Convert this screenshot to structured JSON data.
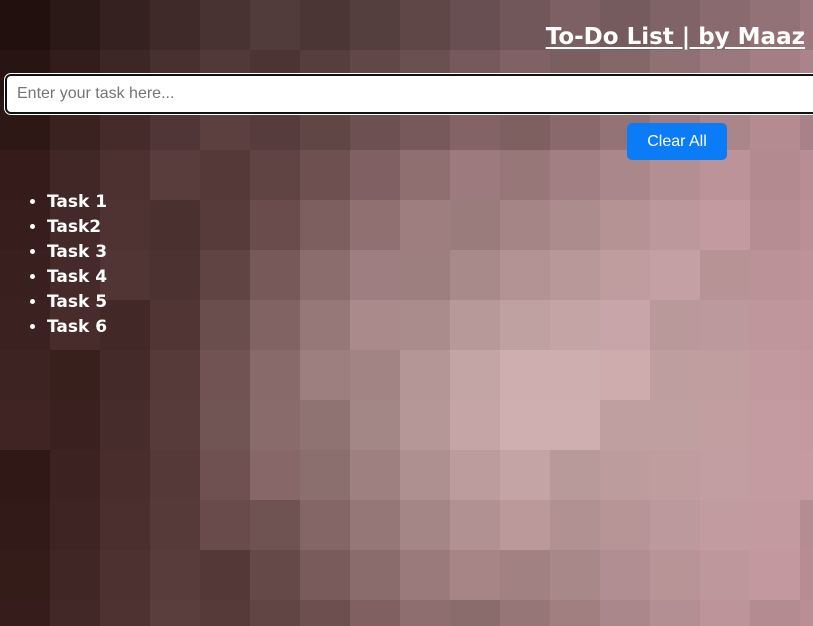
{
  "header": {
    "title": "To-Do List | by Maaz"
  },
  "task_input": {
    "placeholder": "Enter your task here...",
    "value": ""
  },
  "actions": {
    "clear_all_label": "Clear All"
  },
  "tasks": [
    {
      "label": "Task 1"
    },
    {
      "label": "Task2"
    },
    {
      "label": "Task 3"
    },
    {
      "label": "Task 4"
    },
    {
      "label": "Task 5"
    },
    {
      "label": "Task 6"
    }
  ],
  "colors": {
    "button_bg": "#0a7cf7",
    "text": "#ffffff"
  }
}
